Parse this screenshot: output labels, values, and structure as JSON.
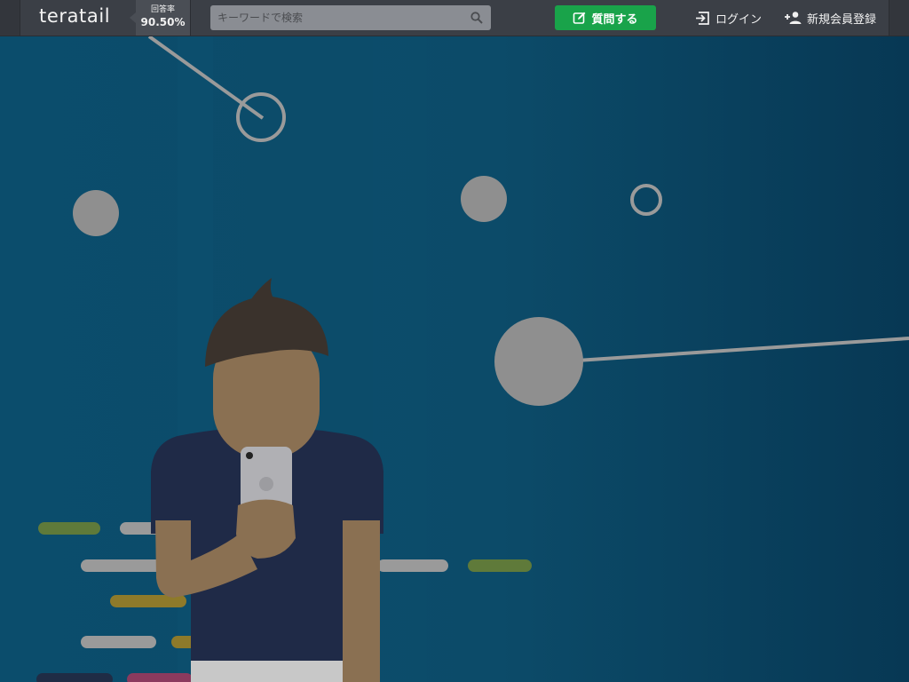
{
  "header": {
    "logo": "teratail",
    "answer_rate": {
      "label": "回答率",
      "value": "90.50%"
    },
    "search": {
      "placeholder": "キーワードで検索"
    },
    "ask_button": "質問する",
    "login": "ログイン",
    "signup": "新規会員登録"
  },
  "icons": {
    "search": "search-icon",
    "ask": "edit-icon",
    "login": "login-icon",
    "signup": "add-user-icon"
  },
  "colors": {
    "header_bg": "#3b3f46",
    "ask_button": "#19a34a",
    "hero_bg": "#0b4d6c"
  }
}
